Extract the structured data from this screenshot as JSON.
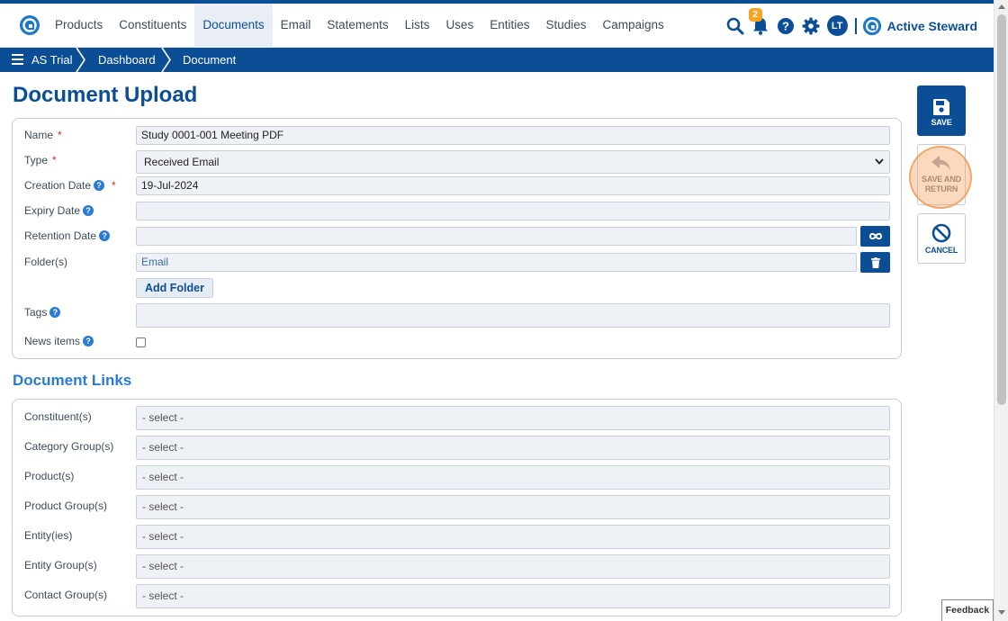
{
  "nav": {
    "items": [
      "Products",
      "Constituents",
      "Documents",
      "Email",
      "Statements",
      "Lists",
      "Uses",
      "Entities",
      "Studies",
      "Campaigns"
    ],
    "active_index": 2,
    "notification_count": "2",
    "avatar_initials": "LT",
    "brand_name": "Active Steward"
  },
  "breadcrumb": {
    "items": [
      "AS Trial",
      "Dashboard",
      "Document"
    ]
  },
  "page": {
    "title": "Document Upload"
  },
  "form": {
    "name_label": "Name",
    "name_value": "Study 0001-001 Meeting PDF",
    "type_label": "Type",
    "type_value": "Received Email",
    "creation_date_label": "Creation Date",
    "creation_date_value": "19-Jul-2024",
    "expiry_date_label": "Expiry Date",
    "expiry_date_value": "",
    "retention_date_label": "Retention Date",
    "retention_date_value": "",
    "folders_label": "Folder(s)",
    "folders_value": "Email",
    "add_folder_label": "Add Folder",
    "tags_label": "Tags",
    "tags_value": "",
    "news_items_label": "News items",
    "required_mark": "*",
    "help_mark": "?"
  },
  "links": {
    "title": "Document Links",
    "placeholder": "- select -",
    "fields": [
      "Constituent(s)",
      "Category Group(s)",
      "Product(s)",
      "Product Group(s)",
      "Entity(ies)",
      "Entity Group(s)",
      "Contact Group(s)"
    ]
  },
  "actions": {
    "save": "SAVE",
    "save_and_return_1": "SAVE AND",
    "save_and_return_2": "RETURN",
    "cancel": "CANCEL"
  },
  "feedback": "Feedback",
  "colors": {
    "primary": "#0b4e96",
    "accent": "#2a7bd4",
    "badge": "#f5a623",
    "required": "#c9302c"
  }
}
